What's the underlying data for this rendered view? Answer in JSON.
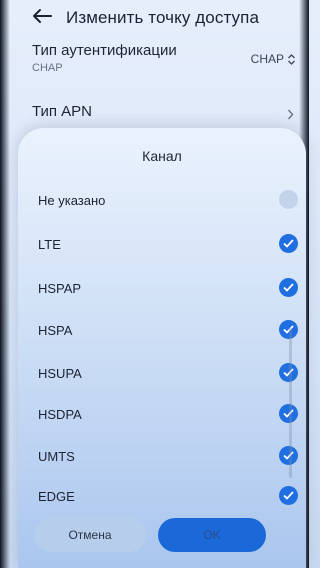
{
  "header": {
    "title": "Изменить точку доступа"
  },
  "auth": {
    "label": "Тип аутентификации",
    "value_sub": "CHAP",
    "value": "CHAP"
  },
  "apn_type": {
    "label": "Тип APN"
  },
  "dialog": {
    "title": "Канал",
    "items": [
      {
        "label": "Не указано",
        "checked": false
      },
      {
        "label": "LTE",
        "checked": true
      },
      {
        "label": "HSPAP",
        "checked": true
      },
      {
        "label": "HSPA",
        "checked": true
      },
      {
        "label": "HSUPA",
        "checked": true
      },
      {
        "label": "HSDPA",
        "checked": true
      },
      {
        "label": "UMTS",
        "checked": true
      },
      {
        "label": "EDGE",
        "checked": true
      }
    ],
    "cancel_label": "Отмена",
    "ok_label": "OK"
  },
  "colors": {
    "accent": "#1f6fe0",
    "background": "#dce7f8"
  },
  "icons": {
    "back": "arrow-left-icon",
    "updown": "chevron-updown-icon",
    "apn": "chevron-right-icon",
    "check": "check-circle-icon"
  }
}
